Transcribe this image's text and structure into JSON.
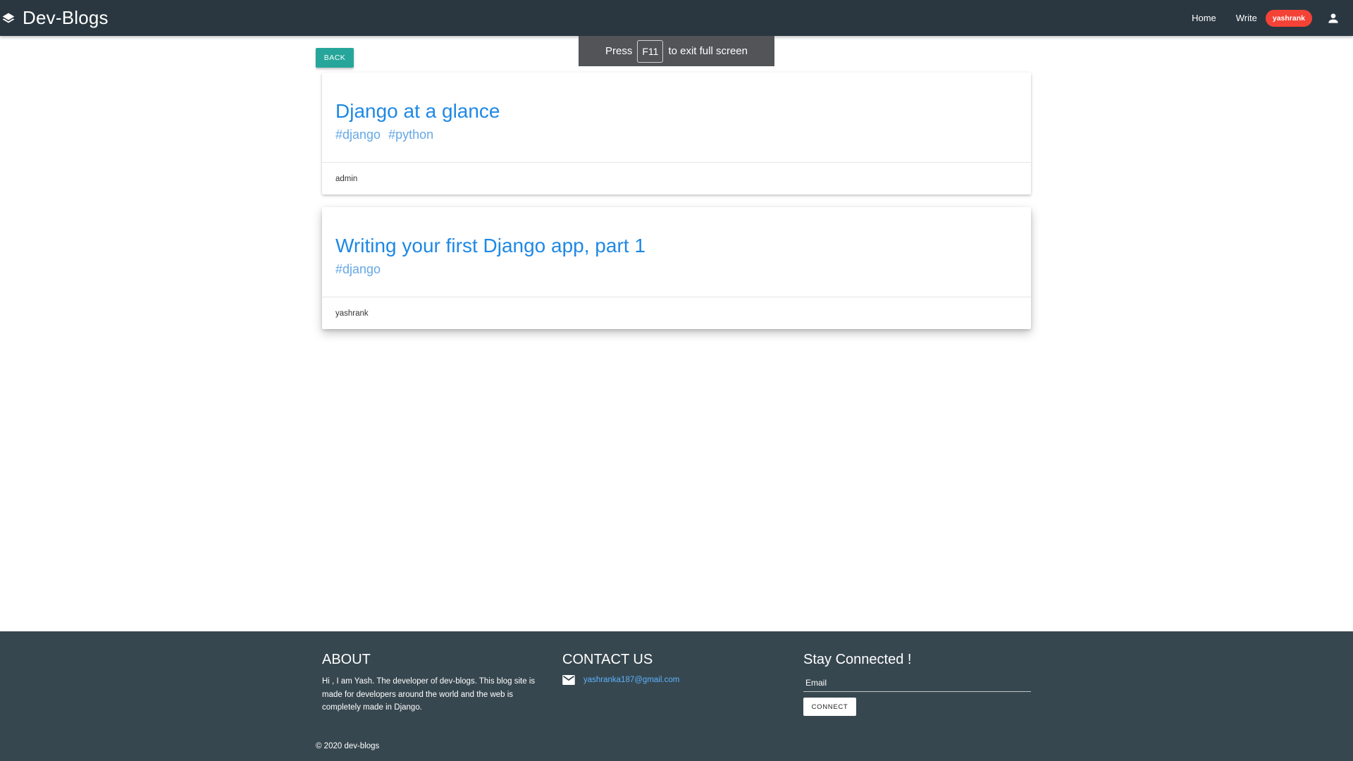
{
  "navbar": {
    "brand": "Dev-Blogs",
    "brand_icon": "layers-icon",
    "links": [
      "Home",
      "Write"
    ],
    "username": "yashrank",
    "account_icon": "account-icon"
  },
  "fullscreen_notice": {
    "prefix": "Press",
    "key": "F11",
    "suffix": "to exit full screen"
  },
  "back_button": "BACK",
  "posts": [
    {
      "title": "Django at a glance",
      "tags": [
        "#django",
        "#python"
      ],
      "author": "admin"
    },
    {
      "title": "Writing your first Django app, part 1",
      "tags": [
        "#django"
      ],
      "author": "yashrank"
    }
  ],
  "footer": {
    "about": {
      "heading": "ABOUT",
      "text": "Hi , I am Yash. The developer of dev-blogs. This blog site is made for developers around the world and the web is completely made in Django."
    },
    "contact": {
      "heading": "CONTACT US",
      "icon": "mail-icon",
      "email": "yashranka187@gmail.com"
    },
    "stay": {
      "heading": "Stay Connected !",
      "email_placeholder": "Email",
      "button": "CONNECT"
    },
    "copyright": "© 2020 dev-blogs"
  },
  "colors": {
    "navbar_bg": "#2a3740",
    "footer_bg": "#37474f",
    "accent_teal": "#26a69a",
    "title_blue": "#1e88e5",
    "badge_red": "#f44336"
  }
}
